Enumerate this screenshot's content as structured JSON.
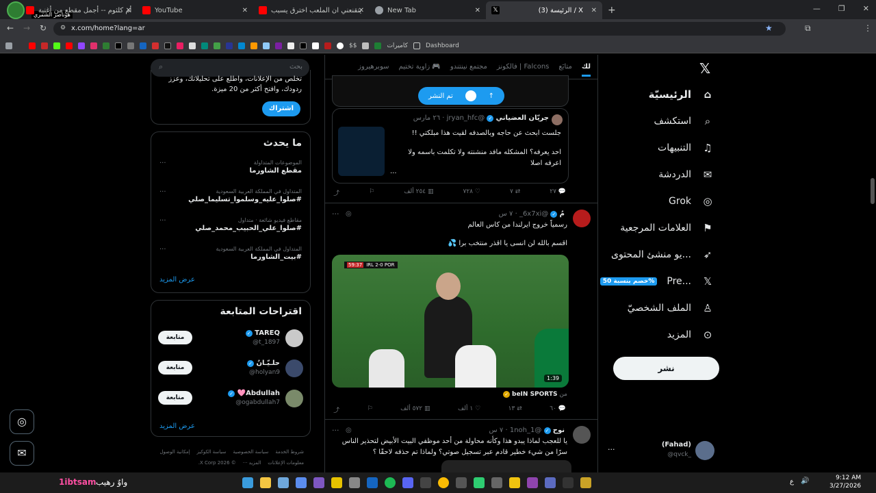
{
  "browser": {
    "profile_name": "هوناصر الشمري",
    "tabs": [
      {
        "label": "أم كلثوم -- أجمل مقطع من أغنية",
        "color": "#ff0000"
      },
      {
        "label": "YouTube",
        "color": "#ff0000"
      },
      {
        "label": "يتقنعني ان الملعب اخترق يسبب",
        "color": "#ff0000"
      },
      {
        "label": "New Tab",
        "color": "#9aa0a6"
      },
      {
        "label": "(3) الرئيسة / X",
        "color": "#ffffff"
      }
    ],
    "url": "x.com/home?lang=ar",
    "bookmarks": {
      "cameras": "كاميرات",
      "dashboard": "Dashboard",
      "dollar": "$$"
    }
  },
  "sidebar": {
    "logo": "x-logo-icon",
    "items": [
      {
        "label": "الرئيسيّة",
        "icon": "home-icon"
      },
      {
        "label": "استكشف",
        "icon": "search-icon"
      },
      {
        "label": "التنبيهات",
        "icon": "bell-icon"
      },
      {
        "label": "الدردشة",
        "icon": "mail-icon"
      },
      {
        "label": "Grok",
        "icon": "grok-icon"
      },
      {
        "label": "العلامات المرجعية",
        "icon": "bookmark-icon"
      },
      {
        "label": "...يو منشئ المحتوى",
        "icon": "rocket-icon"
      },
      {
        "label": "...Pre",
        "icon": "x-icon",
        "badge": "%خصم بنسبة 50"
      },
      {
        "label": "الملف الشخصيّ",
        "icon": "person-icon"
      },
      {
        "label": "المزيد",
        "icon": "more-icon"
      }
    ],
    "post_button": "نشر",
    "account": {
      "name": "(Fahad)",
      "handle": "@qvck_"
    }
  },
  "feed": {
    "tabs": [
      "لك",
      "متابَع",
      "فالكونز | Falcons",
      "مجتمع نينتندو",
      "زاوية تختيم 🎮",
      "سوبرهيروز"
    ],
    "posted_pill": "تم النشر",
    "posts": [
      {
        "name": "جريّان العضياني",
        "handle": "@jryan_hfc",
        "time": "٢٦ مارس",
        "text1": "جلست ابحث عن حاجه وبالصدفه لقيت هذا مبلكتي !!",
        "text2": "احد يعرفه؟ المشكله مافد منشنته ولا تكلمت باسمه ولا اعرفه اصلا",
        "more": "...",
        "replies": "٢٧",
        "reposts": "٧",
        "likes": "٧٢٨",
        "views": "٢٥٤ ألف"
      },
      {
        "name": "مُ",
        "handle": "@6x7xi_",
        "time": "٧ س",
        "text1": "رسمياً خروج ايرلندا من كاس العالم",
        "text2": "اقسم بالله لن انسى يا اقذر منتخب برا 💦",
        "source": "beIN SPORTS",
        "source_prefix": "من",
        "duration": "1:39",
        "score": "IRL 2-0 POR",
        "clock": "59:37",
        "replies": "٦٠",
        "reposts": "١٣",
        "likes": "١ ألف",
        "views": "٥٧٢ ألف"
      },
      {
        "name": "نوح",
        "handle": "@1noh_1",
        "time": "٧ س",
        "text1": "يا للعجب لماذا يبدو هذا وكأنه محاولة من أحد موظفي البيت الأبيض لتحذير الناس سرًا من شيء خطير قادم عبر تسجيل صوتي؟ ولماذا تم حذفه لاحقًا ؟"
      }
    ]
  },
  "right": {
    "search_placeholder": "بحث",
    "premium_text": "تخلص من الإعلانات، واطلع على تحليلاتك، وعزز ردودك، وافتح أكثر من 20 ميزة.",
    "subscribe": "اشتراك",
    "trending_title": "ما يحدث",
    "trends": [
      {
        "meta": "الموضوعات المتداولة",
        "title": "مقطع الشاورما"
      },
      {
        "meta": "المتداول في المملكة العربية السعودية",
        "title": "#صلوا_عليه_وسلموا_تسليما_صلي"
      },
      {
        "meta": "مقاطع فيديو شائعة · متداول",
        "title": "#صلوا_علي_الحبيب_محمد_صلي"
      },
      {
        "meta": "المتداول في المملكة العربية السعودية",
        "title": "#بيت_الشاورما"
      }
    ],
    "show_more": "عرض المزيد",
    "follow_title": "اقتراحات المتابعة",
    "follows": [
      {
        "name": "TAREQ",
        "handle": "@t_1897"
      },
      {
        "name": "حلـيّـانُ",
        "handle": "@holyan9"
      },
      {
        "name": "Abdullah🩷",
        "handle": "@ogabdullah7"
      }
    ],
    "follow_btn": "متابعة",
    "show_more2": "عرض المزيد",
    "footer": [
      "شروط الخدمة",
      "سياسة الخصوصية",
      "سياسة الكوكيز",
      "إمكانية الوصول",
      "معلومات الإعلانات",
      "المزيد ···",
      "© 2026 X Corp."
    ]
  },
  "taskbar": {
    "left_label": "1ibtsam",
    "left_label2": "واوٌ رهيب",
    "time": "9:12 AM",
    "date": "3/27/2026",
    "lang": "ع"
  }
}
